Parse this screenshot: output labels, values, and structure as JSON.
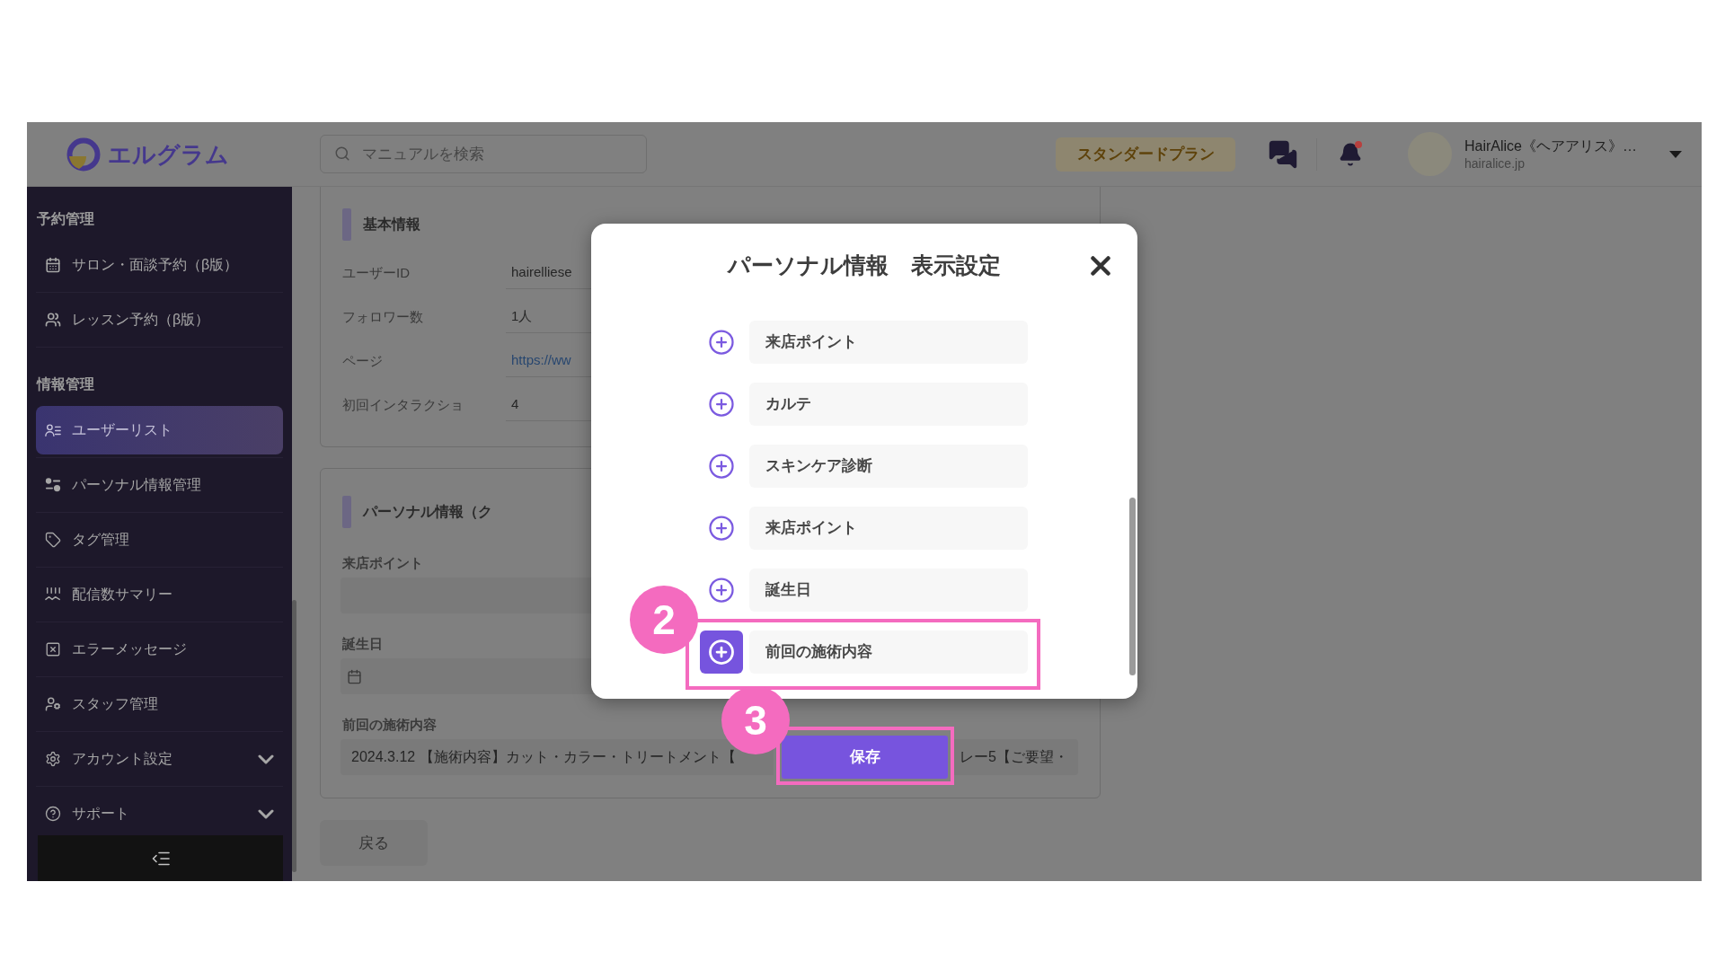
{
  "header": {
    "logo_text": "エルグラム",
    "search": {
      "placeholder": "マニュアルを検索"
    },
    "plan_badge": "スタンダードプラン",
    "notifications": {
      "unread": true
    },
    "user": {
      "name": "HairAlice《ヘアアリス》…",
      "domain": "hairalice.jp"
    }
  },
  "sidebar": {
    "sections": [
      {
        "heading": "予約管理",
        "items": [
          {
            "label": "サロン・面談予約（β版）",
            "kind": "link",
            "selected": false
          },
          {
            "label": "レッスン予約（β版）",
            "kind": "link",
            "selected": false
          }
        ]
      },
      {
        "heading": "情報管理",
        "items": [
          {
            "label": "ユーザーリスト",
            "kind": "link",
            "selected": true
          },
          {
            "label": "パーソナル情報管理",
            "kind": "link",
            "selected": false
          },
          {
            "label": "タグ管理",
            "kind": "link",
            "selected": false
          },
          {
            "label": "配信数サマリー",
            "kind": "link",
            "selected": false
          },
          {
            "label": "エラーメッセージ",
            "kind": "link",
            "selected": false
          },
          {
            "label": "スタッフ管理",
            "kind": "link",
            "selected": false
          },
          {
            "label": "アカウント設定",
            "kind": "group",
            "selected": false
          },
          {
            "label": "サポート",
            "kind": "group",
            "selected": false
          }
        ]
      }
    ]
  },
  "basic_info": {
    "heading": "基本情報",
    "rows": [
      {
        "label": "ユーザーID",
        "value": "hairelliese",
        "kind": "text"
      },
      {
        "label": "フォロワー数",
        "value": "1人",
        "kind": "text"
      },
      {
        "label": "ページ",
        "value": "https://ww",
        "kind": "link"
      },
      {
        "label": "初回インタラクショ",
        "value": "4",
        "kind": "text"
      }
    ]
  },
  "personal_info": {
    "heading": "パーソナル情報（ク",
    "fields": [
      {
        "label": "来店ポイント",
        "kind": "text"
      },
      {
        "label": "誕生日",
        "kind": "date"
      },
      {
        "label": "前回の施術内容",
        "kind": "text",
        "visible_text": [
          "2024.3.12 【施術内容】カット・カラー・トリートメント【",
          "レー5【ご要望・"
        ]
      }
    ]
  },
  "back_button": "戻る",
  "modal": {
    "title": "パーソナル情報　表示設定",
    "items": [
      {
        "label": "来店ポイント",
        "selected": false
      },
      {
        "label": "カルテ",
        "selected": false
      },
      {
        "label": "スキンケア診断",
        "selected": false
      },
      {
        "label": "来店ポイント",
        "selected": false
      },
      {
        "label": "誕生日",
        "selected": false
      },
      {
        "label": "前回の施術内容",
        "selected": true
      }
    ],
    "save_button": "保存"
  },
  "callouts": [
    {
      "number": "2"
    },
    {
      "number": "3"
    }
  ]
}
